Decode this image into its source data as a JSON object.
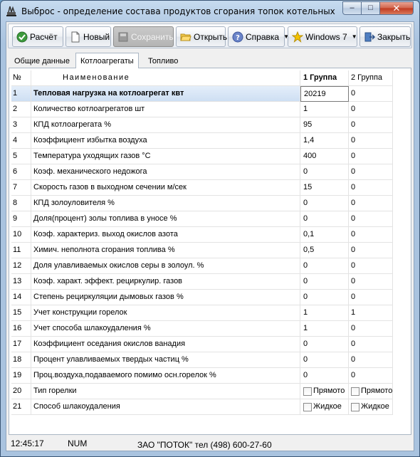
{
  "window": {
    "title": "Выброс - определение состава продуктов сгорания топок котельных",
    "controls": {
      "minimize": "–",
      "maximize": "□",
      "close": "✕"
    }
  },
  "toolbar": [
    {
      "label": "Расчёт",
      "icon": "check-icon",
      "disabled": false
    },
    {
      "label": "Новый",
      "icon": "new-document-icon",
      "disabled": false
    },
    {
      "label": "Сохранить",
      "icon": "save-icon",
      "disabled": true
    },
    {
      "label": "Открыть",
      "icon": "open-folder-icon",
      "disabled": false
    },
    {
      "label": "Справка",
      "icon": "help-icon",
      "disabled": false,
      "dropdown": true
    },
    {
      "label": "Windows 7",
      "icon": "star-icon",
      "disabled": false,
      "dropdown": true
    },
    {
      "label": "Закрыть",
      "icon": "exit-icon",
      "disabled": false
    }
  ],
  "tabs": [
    {
      "label": "Общие данные",
      "active": false
    },
    {
      "label": "Котлоагрегаты",
      "active": true
    },
    {
      "label": "Топливо",
      "active": false
    }
  ],
  "grid": {
    "headers": {
      "num": "№",
      "name": "Наименование",
      "g1": "1 Группа",
      "g2": "2 Группа"
    },
    "rows": [
      {
        "num": "1",
        "name": "Тепловая нагрузка на котлоагрегат        квт",
        "g1": "20219",
        "g2": "0"
      },
      {
        "num": "2",
        "name": "Количество котлоагрегатов                   шт",
        "g1": "1",
        "g2": "0"
      },
      {
        "num": "3",
        "name": "КПД котлоагрегата                 %",
        "g1": "95",
        "g2": "0"
      },
      {
        "num": "4",
        "name": "Коэффициент избытка воздуха",
        "g1": "1,4",
        "g2": "0"
      },
      {
        "num": "5",
        "name": "Температура уходящих  газов             °С",
        "g1": "400",
        "g2": "0"
      },
      {
        "num": "6",
        "name": "Коэф. механического недожога",
        "g1": "0",
        "g2": "0"
      },
      {
        "num": "7",
        "name": "Скорость газов в выходном сечении     м/сек",
        "g1": "15",
        "g2": "0"
      },
      {
        "num": "8",
        "name": "КПД золоуловителя                    %",
        "g1": "0",
        "g2": "0"
      },
      {
        "num": "9",
        "name": "Доля(процент) золы топлива в уносе       %",
        "g1": "0",
        "g2": "0"
      },
      {
        "num": "10",
        "name": "Коэф. характериз. выход окислов азота",
        "g1": "0,1",
        "g2": "0"
      },
      {
        "num": "11",
        "name": "Химич. неполнота сгорания топлива          %",
        "g1": "0,5",
        "g2": "0"
      },
      {
        "num": "12",
        "name": "Доля улавливаемых окислов серы в золоул.  %",
        "g1": "0",
        "g2": "0"
      },
      {
        "num": "13",
        "name": "Коэф. характ. эффект. рециркулир. газов",
        "g1": "0",
        "g2": "0"
      },
      {
        "num": "14",
        "name": "Степень рециркуляции дымовых газов       %",
        "g1": "0",
        "g2": "0"
      },
      {
        "num": "15",
        "name": "Учет конструкции горелок",
        "g1": "1",
        "g2": "1"
      },
      {
        "num": "16",
        "name": "Учет способа шлакоудаления                  %",
        "g1": "1",
        "g2": "0"
      },
      {
        "num": "17",
        "name": "Коэффициент оседания окислов ванадия",
        "g1": "0",
        "g2": "0"
      },
      {
        "num": "18",
        "name": "Процент улавливаемых твердых частиц        %",
        "g1": "0",
        "g2": "0"
      },
      {
        "num": "19",
        "name": "Проц.воздуха,подаваемого помимо осн.горелок %",
        "g1": "0",
        "g2": "0"
      },
      {
        "num": "20",
        "name": "Тип горелки",
        "g1": "Прямото",
        "g2": "Прямото",
        "checkbox": true
      },
      {
        "num": "21",
        "name": "Способ шлакоудаления",
        "g1": "Жидкое",
        "g2": "Жидкое",
        "checkbox": true
      }
    ]
  },
  "status": {
    "time": "12:45:17",
    "num": "NUM",
    "company": "ЗАО \"ПОТОК\" тел (498) 600-27-60"
  }
}
